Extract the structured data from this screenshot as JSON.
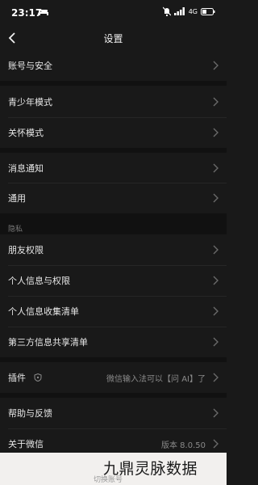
{
  "status": {
    "time": "23:17",
    "network": "4G"
  },
  "nav": {
    "title": "设置"
  },
  "menu": {
    "account": "账号与安全",
    "teen_mode": "青少年模式",
    "care_mode": "关怀模式",
    "notifications": "消息通知",
    "general": "通用",
    "privacy_header": "隐私",
    "friend_permissions": "朋友权限",
    "personal_info_permissions": "个人信息与权限",
    "personal_info_list": "个人信息收集清单",
    "third_party_list": "第三方信息共享清单",
    "plugins": "插件",
    "plugins_value": "微信输入法可以【问 AI】了",
    "help": "帮助与反馈",
    "about": "关于微信",
    "about_value": "版本 8.0.50"
  },
  "bottom": {
    "partial_label": "切换账号",
    "watermark": "九鼎灵脉数据"
  }
}
